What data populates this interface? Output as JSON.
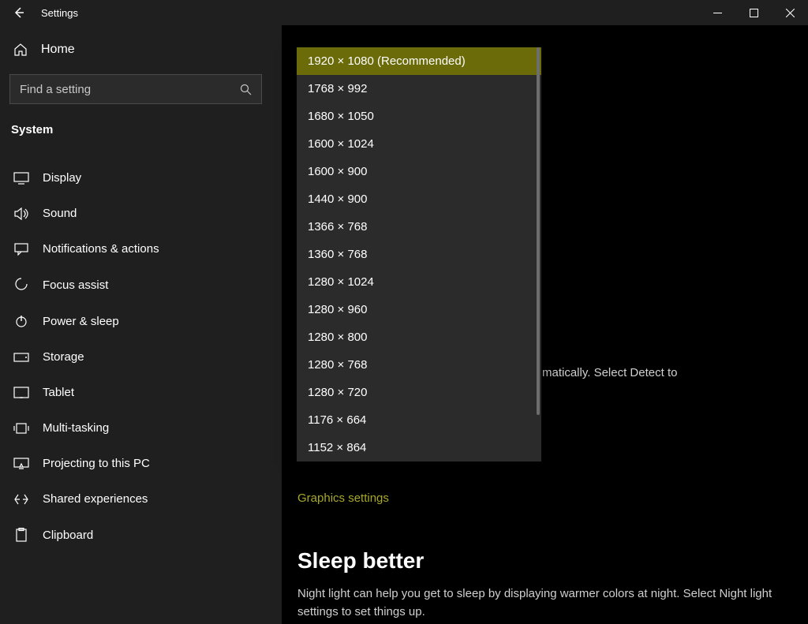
{
  "titlebar": {
    "title": "Settings"
  },
  "sidebar": {
    "home_label": "Home",
    "search_placeholder": "Find a setting",
    "category": "System",
    "items": [
      {
        "icon": "display-icon",
        "label": "Display"
      },
      {
        "icon": "sound-icon",
        "label": "Sound"
      },
      {
        "icon": "notifications-icon",
        "label": "Notifications & actions"
      },
      {
        "icon": "focus-assist-icon",
        "label": "Focus assist"
      },
      {
        "icon": "power-icon",
        "label": "Power & sleep"
      },
      {
        "icon": "storage-icon",
        "label": "Storage"
      },
      {
        "icon": "tablet-icon",
        "label": "Tablet"
      },
      {
        "icon": "multitasking-icon",
        "label": "Multi-tasking"
      },
      {
        "icon": "projecting-icon",
        "label": "Projecting to this PC"
      },
      {
        "icon": "shared-icon",
        "label": "Shared experiences"
      },
      {
        "icon": "clipboard-icon",
        "label": "Clipboard"
      }
    ]
  },
  "resolution_dropdown": {
    "selected_index": 0,
    "options": [
      "1920 × 1080 (Recommended)",
      "1768 × 992",
      "1680 × 1050",
      "1600 × 1024",
      "1600 × 900",
      "1440 × 900",
      "1366 × 768",
      "1360 × 768",
      "1280 × 1024",
      "1280 × 960",
      "1280 × 800",
      "1280 × 768",
      "1280 × 720",
      "1176 × 664",
      "1152 × 864"
    ]
  },
  "content": {
    "partial_text_tail": "matically. Select Detect to",
    "graphics_link": "Graphics settings",
    "sleep_better_title": "Sleep better",
    "sleep_better_body": "Night light can help you get to sleep by displaying warmer colors at night. Select Night light settings to set things up."
  }
}
